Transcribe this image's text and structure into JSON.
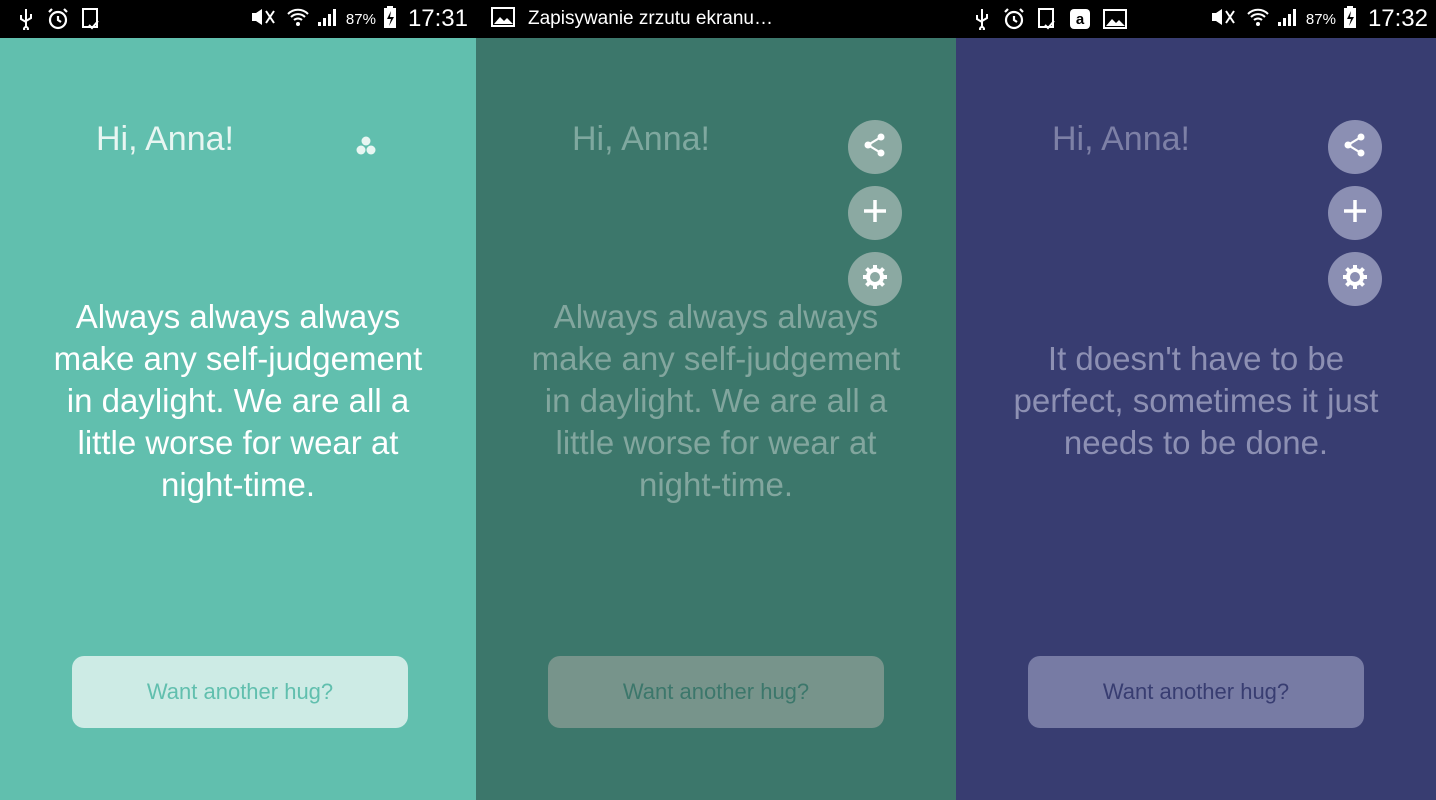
{
  "status_left": {
    "battery_pct": "87%",
    "clock": "17:31",
    "icons": [
      "usb-icon",
      "alarm-icon",
      "screen-icon",
      "mute-icon",
      "wifi-icon",
      "signal-icon",
      "battery-icon"
    ]
  },
  "status_mid": {
    "saving_text": "Zapisywanie zrzutu ekranu…",
    "icons": [
      "image-icon"
    ]
  },
  "status_right": {
    "battery_pct": "87%",
    "clock": "17:32",
    "icons": [
      "usb-icon",
      "alarm-icon",
      "screen-icon",
      "amazon-icon",
      "image-icon",
      "mute-icon",
      "wifi-icon",
      "signal-icon",
      "battery-icon"
    ]
  },
  "panels": [
    {
      "greeting": "Hi, Anna!",
      "quote": "Always always always make any self-judgement in daylight. We are all a little worse for wear at night-time.",
      "button": "Want another hug?",
      "bg": "#61bfae"
    },
    {
      "greeting": "Hi, Anna!",
      "quote": "Always always always make any self-judgement in daylight. We are all a little worse for wear at night-time.",
      "button": "Want another hug?",
      "bg": "#3c776b"
    },
    {
      "greeting": "Hi, Anna!",
      "quote": "It doesn't have to be perfect, sometimes it just needs to be done.",
      "button": "Want another hug?",
      "bg": "#383d71"
    }
  ]
}
